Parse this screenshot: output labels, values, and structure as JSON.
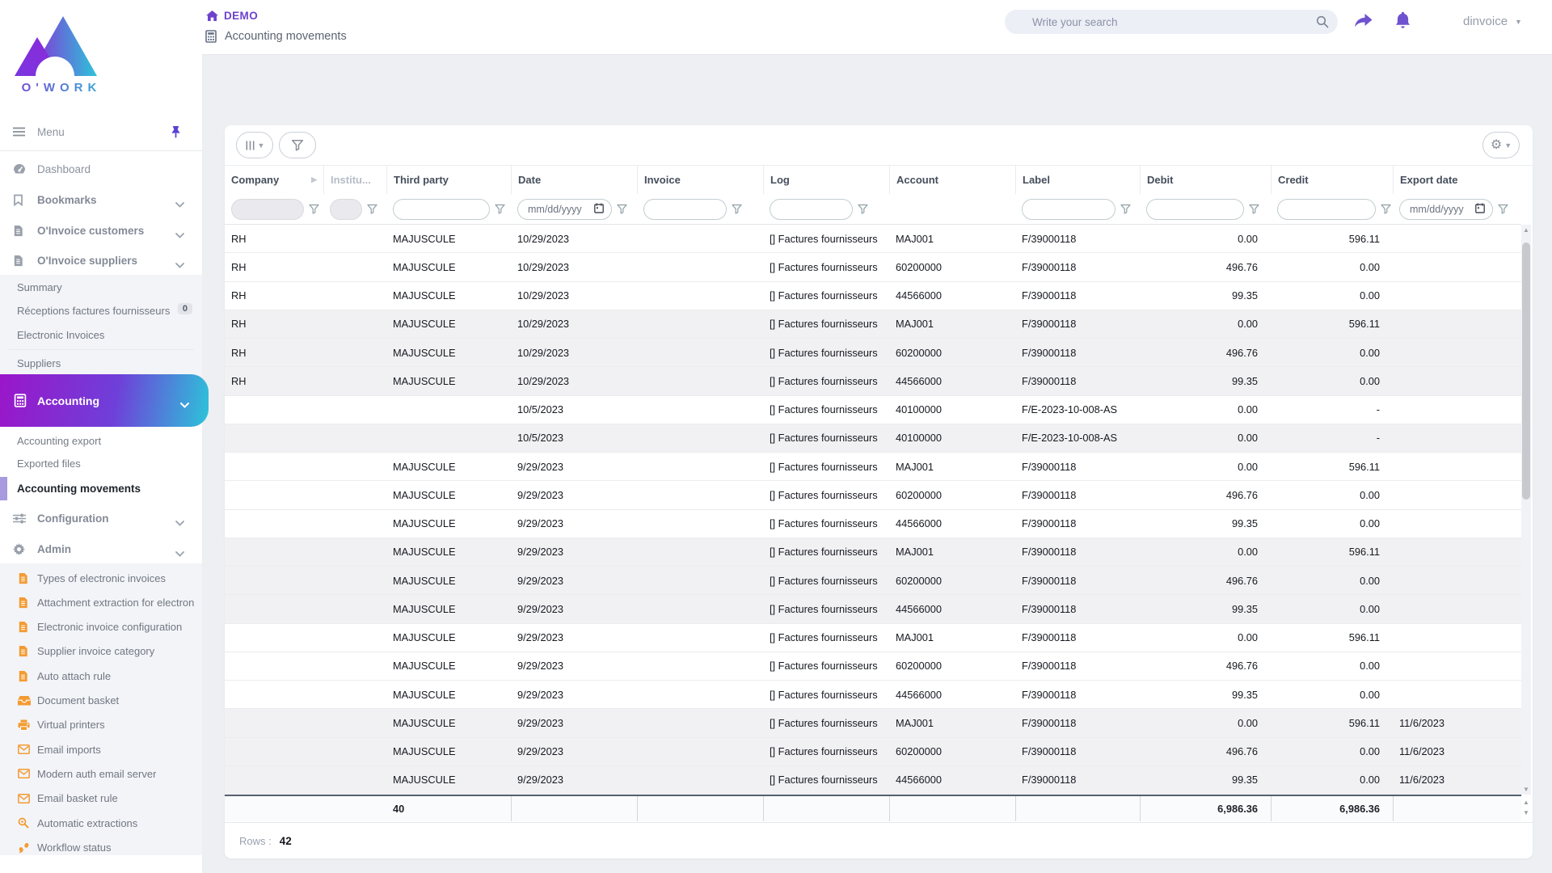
{
  "brand": {
    "wordmark": "O'WORK"
  },
  "topbar": {
    "breadcrumb_env": "DEMO",
    "breadcrumb_page": "Accounting movements",
    "search_placeholder": "Write your search",
    "username": "dinvoice"
  },
  "sidebar": {
    "menu_label": "Menu",
    "dashboard": "Dashboard",
    "bookmarks": "Bookmarks",
    "oinvoice_customers": "O'Invoice customers",
    "oinvoice_suppliers": "O'Invoice suppliers",
    "suppliers_submenu": {
      "summary": "Summary",
      "receptions": "Réceptions factures fournisseurs",
      "receptions_badge": "0",
      "electronic_invoices": "Electronic Invoices",
      "suppliers": "Suppliers"
    },
    "accounting": "Accounting",
    "accounting_submenu": {
      "export": "Accounting export",
      "exported_files": "Exported files",
      "movements": "Accounting movements"
    },
    "configuration": "Configuration",
    "admin": "Admin",
    "admin_submenu": [
      {
        "label": "Types of electronic invoices",
        "icon": "file"
      },
      {
        "label": "Attachment extraction for electron",
        "icon": "file"
      },
      {
        "label": "Electronic invoice configuration",
        "icon": "file"
      },
      {
        "label": "Supplier invoice category",
        "icon": "file"
      },
      {
        "label": "Auto attach rule",
        "icon": "file"
      },
      {
        "label": "Document basket",
        "icon": "basket"
      },
      {
        "label": "Virtual printers",
        "icon": "printer"
      },
      {
        "label": "Email imports",
        "icon": "mail"
      },
      {
        "label": "Modern auth email server",
        "icon": "mail"
      },
      {
        "label": "Email basket rule",
        "icon": "mail"
      },
      {
        "label": "Automatic extractions",
        "icon": "searchplus"
      },
      {
        "label": "Workflow status",
        "icon": "steps"
      }
    ]
  },
  "colors": {
    "accent_purple": "#6d43cc",
    "gradient_start": "#9a16c9",
    "gradient_end": "#2cc4d9",
    "icon_orange": "#f39b33"
  },
  "grid": {
    "date_placeholder": "mm/dd/yyyy",
    "columns": [
      {
        "key": "company",
        "label": "Company",
        "filter": "disabled",
        "sort_indicator": true
      },
      {
        "key": "institution",
        "label": "Institu...",
        "filter": "disabled_small",
        "muted": true
      },
      {
        "key": "third_party",
        "label": "Third party",
        "filter": "text"
      },
      {
        "key": "date",
        "label": "Date",
        "filter": "date"
      },
      {
        "key": "invoice",
        "label": "Invoice",
        "filter": "text"
      },
      {
        "key": "log",
        "label": "Log",
        "filter": "text"
      },
      {
        "key": "account",
        "label": "Account",
        "filter": "none"
      },
      {
        "key": "label",
        "label": "Label",
        "filter": "text"
      },
      {
        "key": "debit",
        "label": "Debit",
        "filter": "text",
        "align": "right"
      },
      {
        "key": "credit",
        "label": "Credit",
        "filter": "text",
        "align": "right"
      },
      {
        "key": "export_date",
        "label": "Export date",
        "filter": "date"
      }
    ],
    "rows": [
      {
        "company": "RH",
        "institution": "",
        "third_party": "MAJUSCULE",
        "date": "10/29/2023",
        "invoice": "",
        "log": "[] Factures fournisseurs",
        "account": "MAJ001",
        "label": "F/39000118",
        "debit": "0.00",
        "credit": "596.11",
        "export_date": "",
        "shaded": false
      },
      {
        "company": "RH",
        "institution": "",
        "third_party": "MAJUSCULE",
        "date": "10/29/2023",
        "invoice": "",
        "log": "[] Factures fournisseurs",
        "account": "60200000",
        "label": "F/39000118",
        "debit": "496.76",
        "credit": "0.00",
        "export_date": "",
        "shaded": false
      },
      {
        "company": "RH",
        "institution": "",
        "third_party": "MAJUSCULE",
        "date": "10/29/2023",
        "invoice": "",
        "log": "[] Factures fournisseurs",
        "account": "44566000",
        "label": "F/39000118",
        "debit": "99.35",
        "credit": "0.00",
        "export_date": "",
        "shaded": false
      },
      {
        "company": "RH",
        "institution": "",
        "third_party": "MAJUSCULE",
        "date": "10/29/2023",
        "invoice": "",
        "log": "[] Factures fournisseurs",
        "account": "MAJ001",
        "label": "F/39000118",
        "debit": "0.00",
        "credit": "596.11",
        "export_date": "",
        "shaded": true
      },
      {
        "company": "RH",
        "institution": "",
        "third_party": "MAJUSCULE",
        "date": "10/29/2023",
        "invoice": "",
        "log": "[] Factures fournisseurs",
        "account": "60200000",
        "label": "F/39000118",
        "debit": "496.76",
        "credit": "0.00",
        "export_date": "",
        "shaded": true
      },
      {
        "company": "RH",
        "institution": "",
        "third_party": "MAJUSCULE",
        "date": "10/29/2023",
        "invoice": "",
        "log": "[] Factures fournisseurs",
        "account": "44566000",
        "label": "F/39000118",
        "debit": "99.35",
        "credit": "0.00",
        "export_date": "",
        "shaded": true
      },
      {
        "company": "",
        "institution": "",
        "third_party": "",
        "date": "10/5/2023",
        "invoice": "",
        "log": "[] Factures fournisseurs",
        "account": "40100000",
        "label": "F/E-2023-10-008-AS",
        "debit": "0.00",
        "credit": "-",
        "export_date": "",
        "shaded": false
      },
      {
        "company": "",
        "institution": "",
        "third_party": "",
        "date": "10/5/2023",
        "invoice": "",
        "log": "[] Factures fournisseurs",
        "account": "40100000",
        "label": "F/E-2023-10-008-AS",
        "debit": "0.00",
        "credit": "-",
        "export_date": "",
        "shaded": true
      },
      {
        "company": "",
        "institution": "",
        "third_party": "MAJUSCULE",
        "date": "9/29/2023",
        "invoice": "",
        "log": "[] Factures fournisseurs",
        "account": "MAJ001",
        "label": "F/39000118",
        "debit": "0.00",
        "credit": "596.11",
        "export_date": "",
        "shaded": false
      },
      {
        "company": "",
        "institution": "",
        "third_party": "MAJUSCULE",
        "date": "9/29/2023",
        "invoice": "",
        "log": "[] Factures fournisseurs",
        "account": "60200000",
        "label": "F/39000118",
        "debit": "496.76",
        "credit": "0.00",
        "export_date": "",
        "shaded": false
      },
      {
        "company": "",
        "institution": "",
        "third_party": "MAJUSCULE",
        "date": "9/29/2023",
        "invoice": "",
        "log": "[] Factures fournisseurs",
        "account": "44566000",
        "label": "F/39000118",
        "debit": "99.35",
        "credit": "0.00",
        "export_date": "",
        "shaded": false
      },
      {
        "company": "",
        "institution": "",
        "third_party": "MAJUSCULE",
        "date": "9/29/2023",
        "invoice": "",
        "log": "[] Factures fournisseurs",
        "account": "MAJ001",
        "label": "F/39000118",
        "debit": "0.00",
        "credit": "596.11",
        "export_date": "",
        "shaded": true
      },
      {
        "company": "",
        "institution": "",
        "third_party": "MAJUSCULE",
        "date": "9/29/2023",
        "invoice": "",
        "log": "[] Factures fournisseurs",
        "account": "60200000",
        "label": "F/39000118",
        "debit": "496.76",
        "credit": "0.00",
        "export_date": "",
        "shaded": true
      },
      {
        "company": "",
        "institution": "",
        "third_party": "MAJUSCULE",
        "date": "9/29/2023",
        "invoice": "",
        "log": "[] Factures fournisseurs",
        "account": "44566000",
        "label": "F/39000118",
        "debit": "99.35",
        "credit": "0.00",
        "export_date": "",
        "shaded": true
      },
      {
        "company": "",
        "institution": "",
        "third_party": "MAJUSCULE",
        "date": "9/29/2023",
        "invoice": "",
        "log": "[] Factures fournisseurs",
        "account": "MAJ001",
        "label": "F/39000118",
        "debit": "0.00",
        "credit": "596.11",
        "export_date": "",
        "shaded": false
      },
      {
        "company": "",
        "institution": "",
        "third_party": "MAJUSCULE",
        "date": "9/29/2023",
        "invoice": "",
        "log": "[] Factures fournisseurs",
        "account": "60200000",
        "label": "F/39000118",
        "debit": "496.76",
        "credit": "0.00",
        "export_date": "",
        "shaded": false
      },
      {
        "company": "",
        "institution": "",
        "third_party": "MAJUSCULE",
        "date": "9/29/2023",
        "invoice": "",
        "log": "[] Factures fournisseurs",
        "account": "44566000",
        "label": "F/39000118",
        "debit": "99.35",
        "credit": "0.00",
        "export_date": "",
        "shaded": false
      },
      {
        "company": "",
        "institution": "",
        "third_party": "MAJUSCULE",
        "date": "9/29/2023",
        "invoice": "",
        "log": "[] Factures fournisseurs",
        "account": "MAJ001",
        "label": "F/39000118",
        "debit": "0.00",
        "credit": "596.11",
        "export_date": "11/6/2023",
        "shaded": true
      },
      {
        "company": "",
        "institution": "",
        "third_party": "MAJUSCULE",
        "date": "9/29/2023",
        "invoice": "",
        "log": "[] Factures fournisseurs",
        "account": "60200000",
        "label": "F/39000118",
        "debit": "496.76",
        "credit": "0.00",
        "export_date": "11/6/2023",
        "shaded": true
      },
      {
        "company": "",
        "institution": "",
        "third_party": "MAJUSCULE",
        "date": "9/29/2023",
        "invoice": "",
        "log": "[] Factures fournisseurs",
        "account": "44566000",
        "label": "F/39000118",
        "debit": "99.35",
        "credit": "0.00",
        "export_date": "11/6/2023",
        "shaded": true
      }
    ],
    "totals": {
      "company": "",
      "institution": "",
      "third_party": "40",
      "date": "",
      "invoice": "",
      "log": "",
      "account": "",
      "label": "",
      "debit": "6,986.36",
      "credit": "6,986.36",
      "export_date": ""
    },
    "rows_label": "Rows :",
    "rows_count": "42"
  }
}
